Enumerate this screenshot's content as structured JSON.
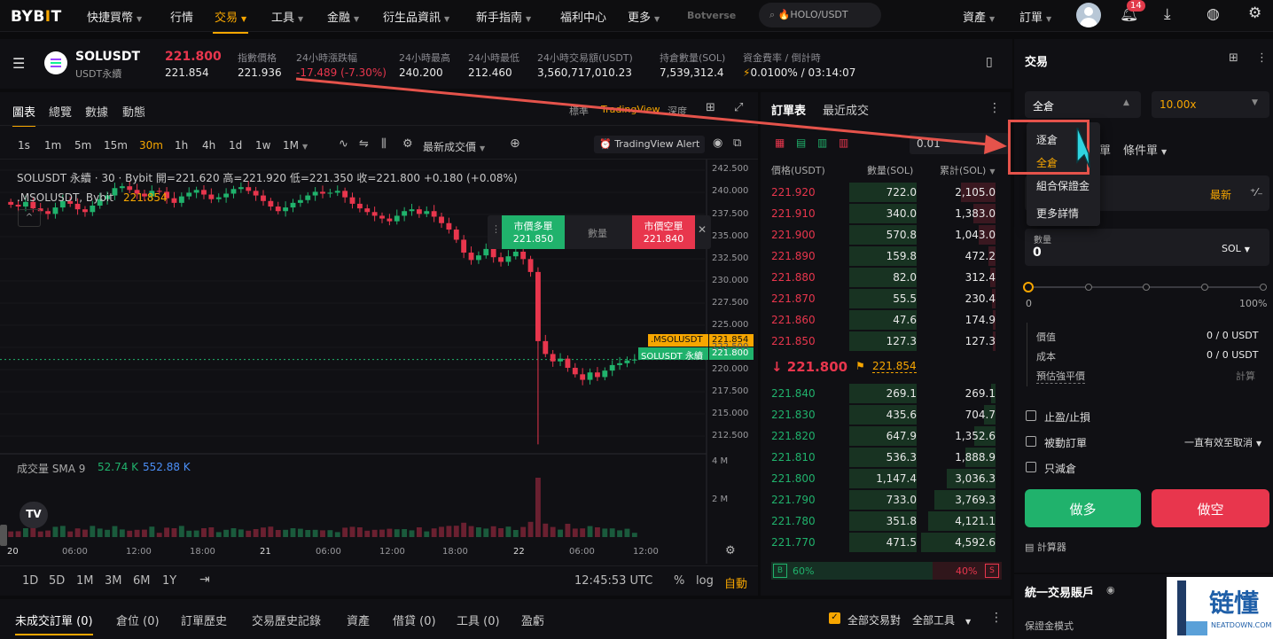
{
  "nav": {
    "logo": "BYBIT",
    "items": [
      "快捷買幣",
      "行情",
      "交易",
      "工具",
      "金融",
      "衍生品資訊",
      "新手指南",
      "福利中心",
      "更多",
      "Botverse"
    ],
    "search_placeholder": "🔥HOLO/USDT",
    "assets": "資產",
    "orders": "訂單",
    "notif_count": "14"
  },
  "ticker": {
    "symbol": "SOLUSDT",
    "subtitle": "USDT永續",
    "last_price": "221.800",
    "mark_price": "221.854",
    "stats": [
      {
        "label": "指數價格",
        "value": "221.936"
      },
      {
        "label": "24小時漲跌幅",
        "value": "-17.489 (-7.30%)"
      },
      {
        "label": "24小時最高",
        "value": "240.200"
      },
      {
        "label": "24小時最低",
        "value": "212.460"
      },
      {
        "label": "24小時交易額(USDT)",
        "value": "3,560,717,010.23"
      },
      {
        "label": "持倉數量(SOL)",
        "value": "7,539,312.4"
      },
      {
        "label": "資金費率 / 倒計時",
        "value": "0.0100% / 03:14:07"
      }
    ]
  },
  "chart": {
    "tabs": [
      "圖表",
      "總覽",
      "數據",
      "動態"
    ],
    "view_modes": [
      "標準",
      "TradingView",
      "深度"
    ],
    "timeframes": [
      "1s",
      "1m",
      "5m",
      "15m",
      "30m",
      "1h",
      "4h",
      "1d",
      "1w",
      "1M"
    ],
    "active_timeframe": "30m",
    "latest_price_label": "最新成交價",
    "alert_label": "TradingView Alert",
    "legend_line1": "SOLUSDT 永續 · 30 · Bybit  開=221.620 高=221.920 低=221.350 收=221.800 +0.180 (+0.08%)",
    "legend_line2": ".MSOLUSDT, Bybit",
    "legend_line2_val": "221.854",
    "market_long_label": "市價多單",
    "market_long_price": "221.850",
    "qty_label": "數量",
    "market_short_label": "市價空單",
    "market_short_price": "221.840",
    "tag_mark_label": ".MSOLUSDT",
    "tag_mark_value": "221.854",
    "tag_last_label": "SOLUSDT 永續",
    "tag_last_value": "221.800",
    "y_ticks": [
      "242.500",
      "240.000",
      "237.500",
      "235.000",
      "232.500",
      "230.000",
      "227.500",
      "225.000",
      "222.500",
      "220.000",
      "217.500",
      "215.000",
      "212.500"
    ],
    "vol_ticks": [
      "4 M",
      "2 M"
    ],
    "x_ticks": [
      "20",
      "06:00",
      "12:00",
      "18:00",
      "21",
      "06:00",
      "12:00",
      "18:00",
      "22",
      "06:00",
      "12:00"
    ],
    "volume_label": "成交量 SMA 9",
    "vol_green": "52.74 K",
    "vol_blue": "552.88 K",
    "ranges": [
      "1D",
      "5D",
      "1M",
      "3M",
      "6M",
      "1Y"
    ],
    "clock": "12:45:53 UTC",
    "pct": "%",
    "log": "log",
    "auto": "自動"
  },
  "chart_data": {
    "type": "candlestick",
    "title": "SOLUSDT 永續 · 30 · Bybit",
    "ylim": [
      211,
      243.5
    ],
    "close_series": [
      238.6,
      238.4,
      238.9,
      238.2,
      237.9,
      237.6,
      238.3,
      239.0,
      238.7,
      238.1,
      237.8,
      238.5,
      239.2,
      239.6,
      240.4,
      240.6,
      240.2,
      239.8,
      239.5,
      240.1,
      240.0,
      239.3,
      238.8,
      239.5,
      239.9,
      240.2,
      239.7,
      239.2,
      239.4,
      239.8,
      240.3,
      240.5,
      240.1,
      239.6,
      239.0,
      238.4,
      237.9,
      238.3,
      238.8,
      239.1,
      239.6,
      240.0,
      239.8,
      239.9,
      240.1,
      239.4,
      238.7,
      238.2,
      237.8,
      237.4,
      237.1,
      236.8,
      237.4,
      237.9,
      238.1,
      237.6,
      237.9,
      237.3,
      236.6,
      235.9,
      234.8,
      233.4,
      232.6,
      233.1,
      233.8,
      232.9,
      232.4,
      233.0,
      233.5,
      232.7,
      231.3,
      223.8,
      222.4,
      221.6,
      221.9,
      220.9,
      220.2,
      219.6,
      220.4,
      219.9,
      220.6,
      221.2,
      221.4,
      221.7,
      221.8
    ]
  },
  "orderbook": {
    "tabs": [
      "訂單表",
      "最近成交"
    ],
    "step": "0.01",
    "headers": [
      "價格(USDT)",
      "數量(SOL)",
      "累計(SOL)"
    ],
    "asks": [
      {
        "p": "221.920",
        "q": "722.0",
        "t": "2,105.0",
        "qf": 0.75,
        "tf": 0.46
      },
      {
        "p": "221.910",
        "q": "340.0",
        "t": "1,383.0",
        "qf": 0.36,
        "tf": 0.3
      },
      {
        "p": "221.900",
        "q": "570.8",
        "t": "1,043.0",
        "qf": 0.6,
        "tf": 0.23
      },
      {
        "p": "221.890",
        "q": "159.8",
        "t": "472.2",
        "qf": 0.17,
        "tf": 0.1
      },
      {
        "p": "221.880",
        "q": "82.0",
        "t": "312.4",
        "qf": 0.09,
        "tf": 0.07
      },
      {
        "p": "221.870",
        "q": "55.5",
        "t": "230.4",
        "qf": 0.06,
        "tf": 0.05
      },
      {
        "p": "221.860",
        "q": "47.6",
        "t": "174.9",
        "qf": 0.05,
        "tf": 0.04
      },
      {
        "p": "221.850",
        "q": "127.3",
        "t": "127.3",
        "qf": 0.13,
        "tf": 0.03
      }
    ],
    "mid_price": "221.800",
    "mid_mark": "221.854",
    "bids": [
      {
        "p": "221.840",
        "q": "269.1",
        "t": "269.1",
        "qf": 0.28,
        "tf": 0.06
      },
      {
        "p": "221.830",
        "q": "435.6",
        "t": "704.7",
        "qf": 0.45,
        "tf": 0.15
      },
      {
        "p": "221.820",
        "q": "647.9",
        "t": "1,352.6",
        "qf": 0.67,
        "tf": 0.29
      },
      {
        "p": "221.810",
        "q": "536.3",
        "t": "1,888.9",
        "qf": 0.56,
        "tf": 0.41
      },
      {
        "p": "221.800",
        "q": "1,147.4",
        "t": "3,036.3",
        "qf": 1.0,
        "tf": 0.66
      },
      {
        "p": "221.790",
        "q": "733.0",
        "t": "3,769.3",
        "qf": 0.76,
        "tf": 0.82
      },
      {
        "p": "221.780",
        "q": "351.8",
        "t": "4,121.1",
        "qf": 0.37,
        "tf": 0.9
      },
      {
        "p": "221.770",
        "q": "471.5",
        "t": "4,592.6",
        "qf": 0.49,
        "tf": 1.0
      }
    ],
    "buy_tag": "B",
    "buy_pct": "60%",
    "sell_pct": "40%",
    "sell_tag": "S"
  },
  "trade": {
    "title": "交易",
    "margin_mode": "全倉",
    "leverage": "10.00x",
    "order_type_frag": "單",
    "conditional": "條件單",
    "latest": "最新",
    "qty_label": "數量",
    "qty_value": "0",
    "qty_unit": "SOL",
    "slider_min": "0",
    "slider_max": "100%",
    "slider_level": 0,
    "value_label": "價值",
    "value_val": "0 / 0 USDT",
    "cost_label": "成本",
    "cost_val": "0 / 0 USDT",
    "liq_label": "預估強平價",
    "liq_val": "計算",
    "tp_sl": "止盈/止損",
    "post_only": "被動訂單",
    "tif": "一直有效至取消",
    "reduce_only": "只減倉",
    "long_btn": "做多",
    "short_btn": "做空",
    "calculator": "計算器",
    "account_title": "統一交易賬戶",
    "margin_mode_label": "保證金模式",
    "dropdown": [
      "逐倉",
      "全倉",
      "組合保證金",
      "更多詳情"
    ]
  },
  "bottom": {
    "tabs": [
      "未成交訂單 (0)",
      "倉位 (0)",
      "訂單歷史",
      "交易歷史記錄",
      "資產",
      "借貸 (0)",
      "工具 (0)",
      "盈虧"
    ],
    "all_pairs": "全部交易對",
    "all_tools": "全部工具"
  },
  "watermark": {
    "cn": "链懂",
    "en": "NEATDOWN.COM"
  },
  "colors": {
    "accent": "#f7a600",
    "green": "#20b26c",
    "red": "#e8364d",
    "annotation": "#e5534b"
  }
}
